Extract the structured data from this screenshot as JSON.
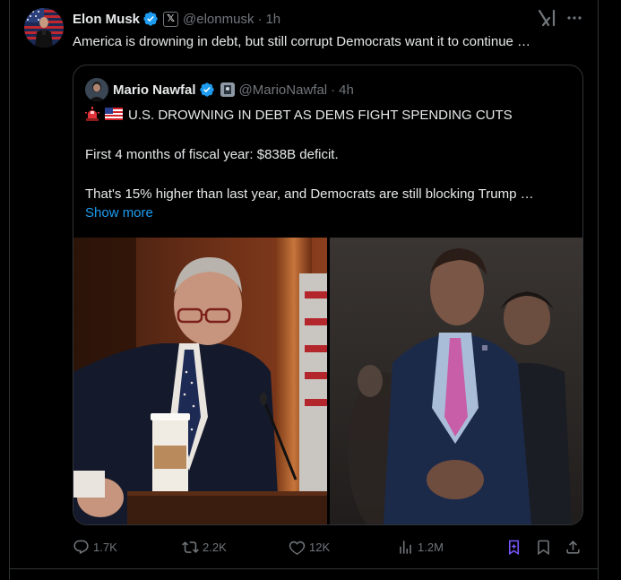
{
  "tweet": {
    "author_name": "Elon Musk",
    "handle": "@elonmusk",
    "separator": "·",
    "time": "1h",
    "affiliate_badge": "𝕏",
    "text": "America is drowning in debt, but still corrupt Democrats want it to continue …"
  },
  "quoted": {
    "author_name": "Mario Nawfal",
    "handle": "@MarioNawfal",
    "separator": "·",
    "time": "4h",
    "headline": "U.S. DROWNING IN DEBT AS DEMS FIGHT SPENDING CUTS",
    "line1": "First 4 months of fiscal year: $838B deficit.",
    "line2": "That's 15% higher than last year, and Democrats are still blocking Trump …",
    "show_more": "Show more",
    "emoji_icons": [
      "rotating-light-icon",
      "us-flag-icon"
    ]
  },
  "actions": {
    "replies": "1.7K",
    "reposts": "2.2K",
    "likes": "12K",
    "views": "1.2M"
  },
  "colors": {
    "background": "#000000",
    "text": "#e7e9ea",
    "muted": "#71767b",
    "link": "#1d9bf0",
    "verified": "#1d9bf0",
    "grok_active": "#7856ff",
    "border": "#2f3336"
  }
}
